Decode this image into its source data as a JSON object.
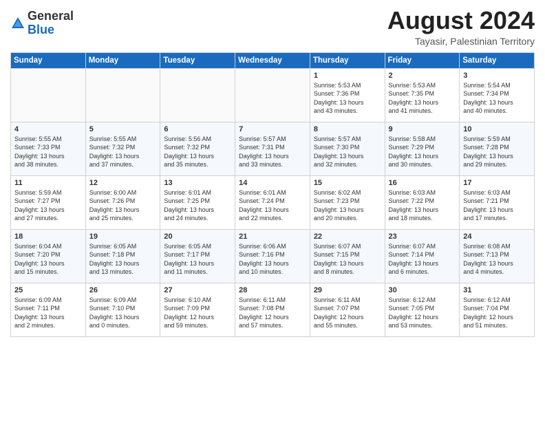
{
  "header": {
    "logo_line1": "General",
    "logo_line2": "Blue",
    "month_year": "August 2024",
    "location": "Tayasir, Palestinian Territory"
  },
  "weekdays": [
    "Sunday",
    "Monday",
    "Tuesday",
    "Wednesday",
    "Thursday",
    "Friday",
    "Saturday"
  ],
  "weeks": [
    [
      {
        "day": "",
        "content": ""
      },
      {
        "day": "",
        "content": ""
      },
      {
        "day": "",
        "content": ""
      },
      {
        "day": "",
        "content": ""
      },
      {
        "day": "1",
        "content": "Sunrise: 5:53 AM\nSunset: 7:36 PM\nDaylight: 13 hours\nand 43 minutes."
      },
      {
        "day": "2",
        "content": "Sunrise: 5:53 AM\nSunset: 7:35 PM\nDaylight: 13 hours\nand 41 minutes."
      },
      {
        "day": "3",
        "content": "Sunrise: 5:54 AM\nSunset: 7:34 PM\nDaylight: 13 hours\nand 40 minutes."
      }
    ],
    [
      {
        "day": "4",
        "content": "Sunrise: 5:55 AM\nSunset: 7:33 PM\nDaylight: 13 hours\nand 38 minutes."
      },
      {
        "day": "5",
        "content": "Sunrise: 5:55 AM\nSunset: 7:32 PM\nDaylight: 13 hours\nand 37 minutes."
      },
      {
        "day": "6",
        "content": "Sunrise: 5:56 AM\nSunset: 7:32 PM\nDaylight: 13 hours\nand 35 minutes."
      },
      {
        "day": "7",
        "content": "Sunrise: 5:57 AM\nSunset: 7:31 PM\nDaylight: 13 hours\nand 33 minutes."
      },
      {
        "day": "8",
        "content": "Sunrise: 5:57 AM\nSunset: 7:30 PM\nDaylight: 13 hours\nand 32 minutes."
      },
      {
        "day": "9",
        "content": "Sunrise: 5:58 AM\nSunset: 7:29 PM\nDaylight: 13 hours\nand 30 minutes."
      },
      {
        "day": "10",
        "content": "Sunrise: 5:59 AM\nSunset: 7:28 PM\nDaylight: 13 hours\nand 29 minutes."
      }
    ],
    [
      {
        "day": "11",
        "content": "Sunrise: 5:59 AM\nSunset: 7:27 PM\nDaylight: 13 hours\nand 27 minutes."
      },
      {
        "day": "12",
        "content": "Sunrise: 6:00 AM\nSunset: 7:26 PM\nDaylight: 13 hours\nand 25 minutes."
      },
      {
        "day": "13",
        "content": "Sunrise: 6:01 AM\nSunset: 7:25 PM\nDaylight: 13 hours\nand 24 minutes."
      },
      {
        "day": "14",
        "content": "Sunrise: 6:01 AM\nSunset: 7:24 PM\nDaylight: 13 hours\nand 22 minutes."
      },
      {
        "day": "15",
        "content": "Sunrise: 6:02 AM\nSunset: 7:23 PM\nDaylight: 13 hours\nand 20 minutes."
      },
      {
        "day": "16",
        "content": "Sunrise: 6:03 AM\nSunset: 7:22 PM\nDaylight: 13 hours\nand 18 minutes."
      },
      {
        "day": "17",
        "content": "Sunrise: 6:03 AM\nSunset: 7:21 PM\nDaylight: 13 hours\nand 17 minutes."
      }
    ],
    [
      {
        "day": "18",
        "content": "Sunrise: 6:04 AM\nSunset: 7:20 PM\nDaylight: 13 hours\nand 15 minutes."
      },
      {
        "day": "19",
        "content": "Sunrise: 6:05 AM\nSunset: 7:18 PM\nDaylight: 13 hours\nand 13 minutes."
      },
      {
        "day": "20",
        "content": "Sunrise: 6:05 AM\nSunset: 7:17 PM\nDaylight: 13 hours\nand 11 minutes."
      },
      {
        "day": "21",
        "content": "Sunrise: 6:06 AM\nSunset: 7:16 PM\nDaylight: 13 hours\nand 10 minutes."
      },
      {
        "day": "22",
        "content": "Sunrise: 6:07 AM\nSunset: 7:15 PM\nDaylight: 13 hours\nand 8 minutes."
      },
      {
        "day": "23",
        "content": "Sunrise: 6:07 AM\nSunset: 7:14 PM\nDaylight: 13 hours\nand 6 minutes."
      },
      {
        "day": "24",
        "content": "Sunrise: 6:08 AM\nSunset: 7:13 PM\nDaylight: 13 hours\nand 4 minutes."
      }
    ],
    [
      {
        "day": "25",
        "content": "Sunrise: 6:09 AM\nSunset: 7:11 PM\nDaylight: 13 hours\nand 2 minutes."
      },
      {
        "day": "26",
        "content": "Sunrise: 6:09 AM\nSunset: 7:10 PM\nDaylight: 13 hours\nand 0 minutes."
      },
      {
        "day": "27",
        "content": "Sunrise: 6:10 AM\nSunset: 7:09 PM\nDaylight: 12 hours\nand 59 minutes."
      },
      {
        "day": "28",
        "content": "Sunrise: 6:11 AM\nSunset: 7:08 PM\nDaylight: 12 hours\nand 57 minutes."
      },
      {
        "day": "29",
        "content": "Sunrise: 6:11 AM\nSunset: 7:07 PM\nDaylight: 12 hours\nand 55 minutes."
      },
      {
        "day": "30",
        "content": "Sunrise: 6:12 AM\nSunset: 7:05 PM\nDaylight: 12 hours\nand 53 minutes."
      },
      {
        "day": "31",
        "content": "Sunrise: 6:12 AM\nSunset: 7:04 PM\nDaylight: 12 hours\nand 51 minutes."
      }
    ]
  ]
}
